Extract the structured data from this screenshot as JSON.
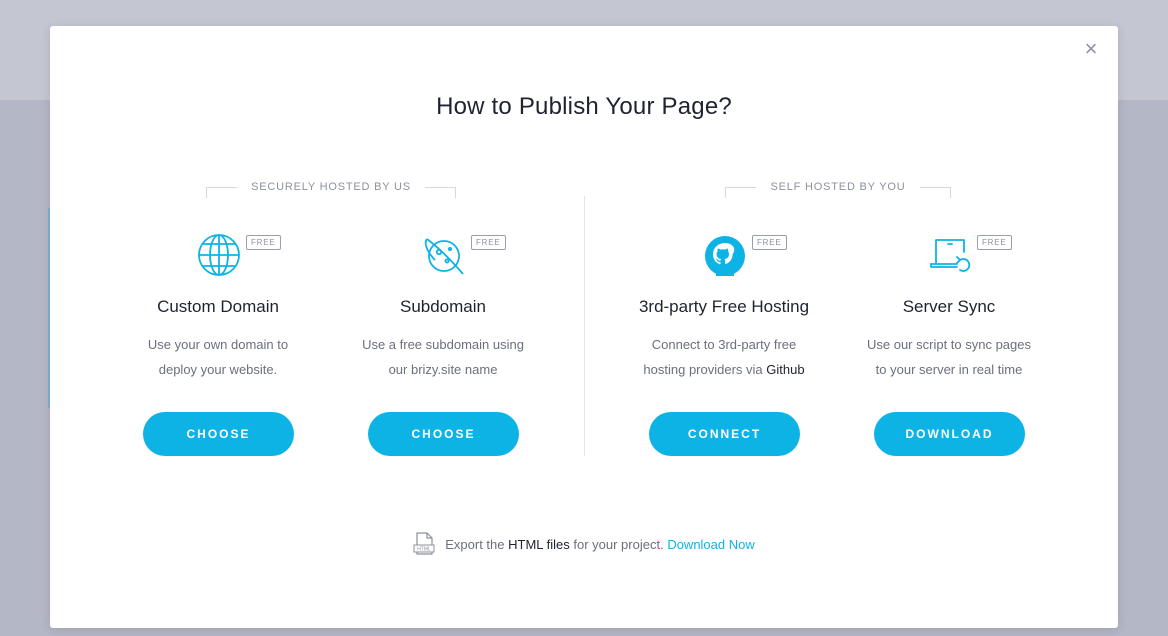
{
  "modal": {
    "title": "How to Publish Your Page?",
    "close_glyph": "×"
  },
  "sections": {
    "hosted": "SECURELY HOSTED BY US",
    "self": "SELF HOSTED BY YOU"
  },
  "options": [
    {
      "icon": "globe-icon",
      "badge": "FREE",
      "name": "Custom Domain",
      "desc_line1": "Use your own domain to",
      "desc_line2": "deploy your website.",
      "button": "CHOOSE"
    },
    {
      "icon": "planet-icon",
      "badge": "FREE",
      "name": "Subdomain",
      "desc_line1": "Use a free subdomain using",
      "desc_line2": "our brizy.site name",
      "button": "CHOOSE"
    },
    {
      "icon": "github-icon",
      "badge": "FREE",
      "name": "3rd-party Free Hosting",
      "desc_line1": "Connect to 3rd-party free",
      "desc_line2_prefix": "hosting providers via ",
      "desc_line2_strong": "Github",
      "button": "CONNECT"
    },
    {
      "icon": "laptop-sync-icon",
      "badge": "FREE",
      "name": "Server Sync",
      "desc_line1": "Use our script to sync pages",
      "desc_line2": "to your server in real time",
      "button": "DOWNLOAD"
    }
  ],
  "export": {
    "icon": "html-file-icon",
    "file_icon_label": "HTML",
    "prefix": "Export the ",
    "strong": "HTML files",
    "middle": " for your project. ",
    "link": "Download Now"
  },
  "colors": {
    "accent": "#0eb3e6",
    "backdrop": "#b4b7c6"
  }
}
